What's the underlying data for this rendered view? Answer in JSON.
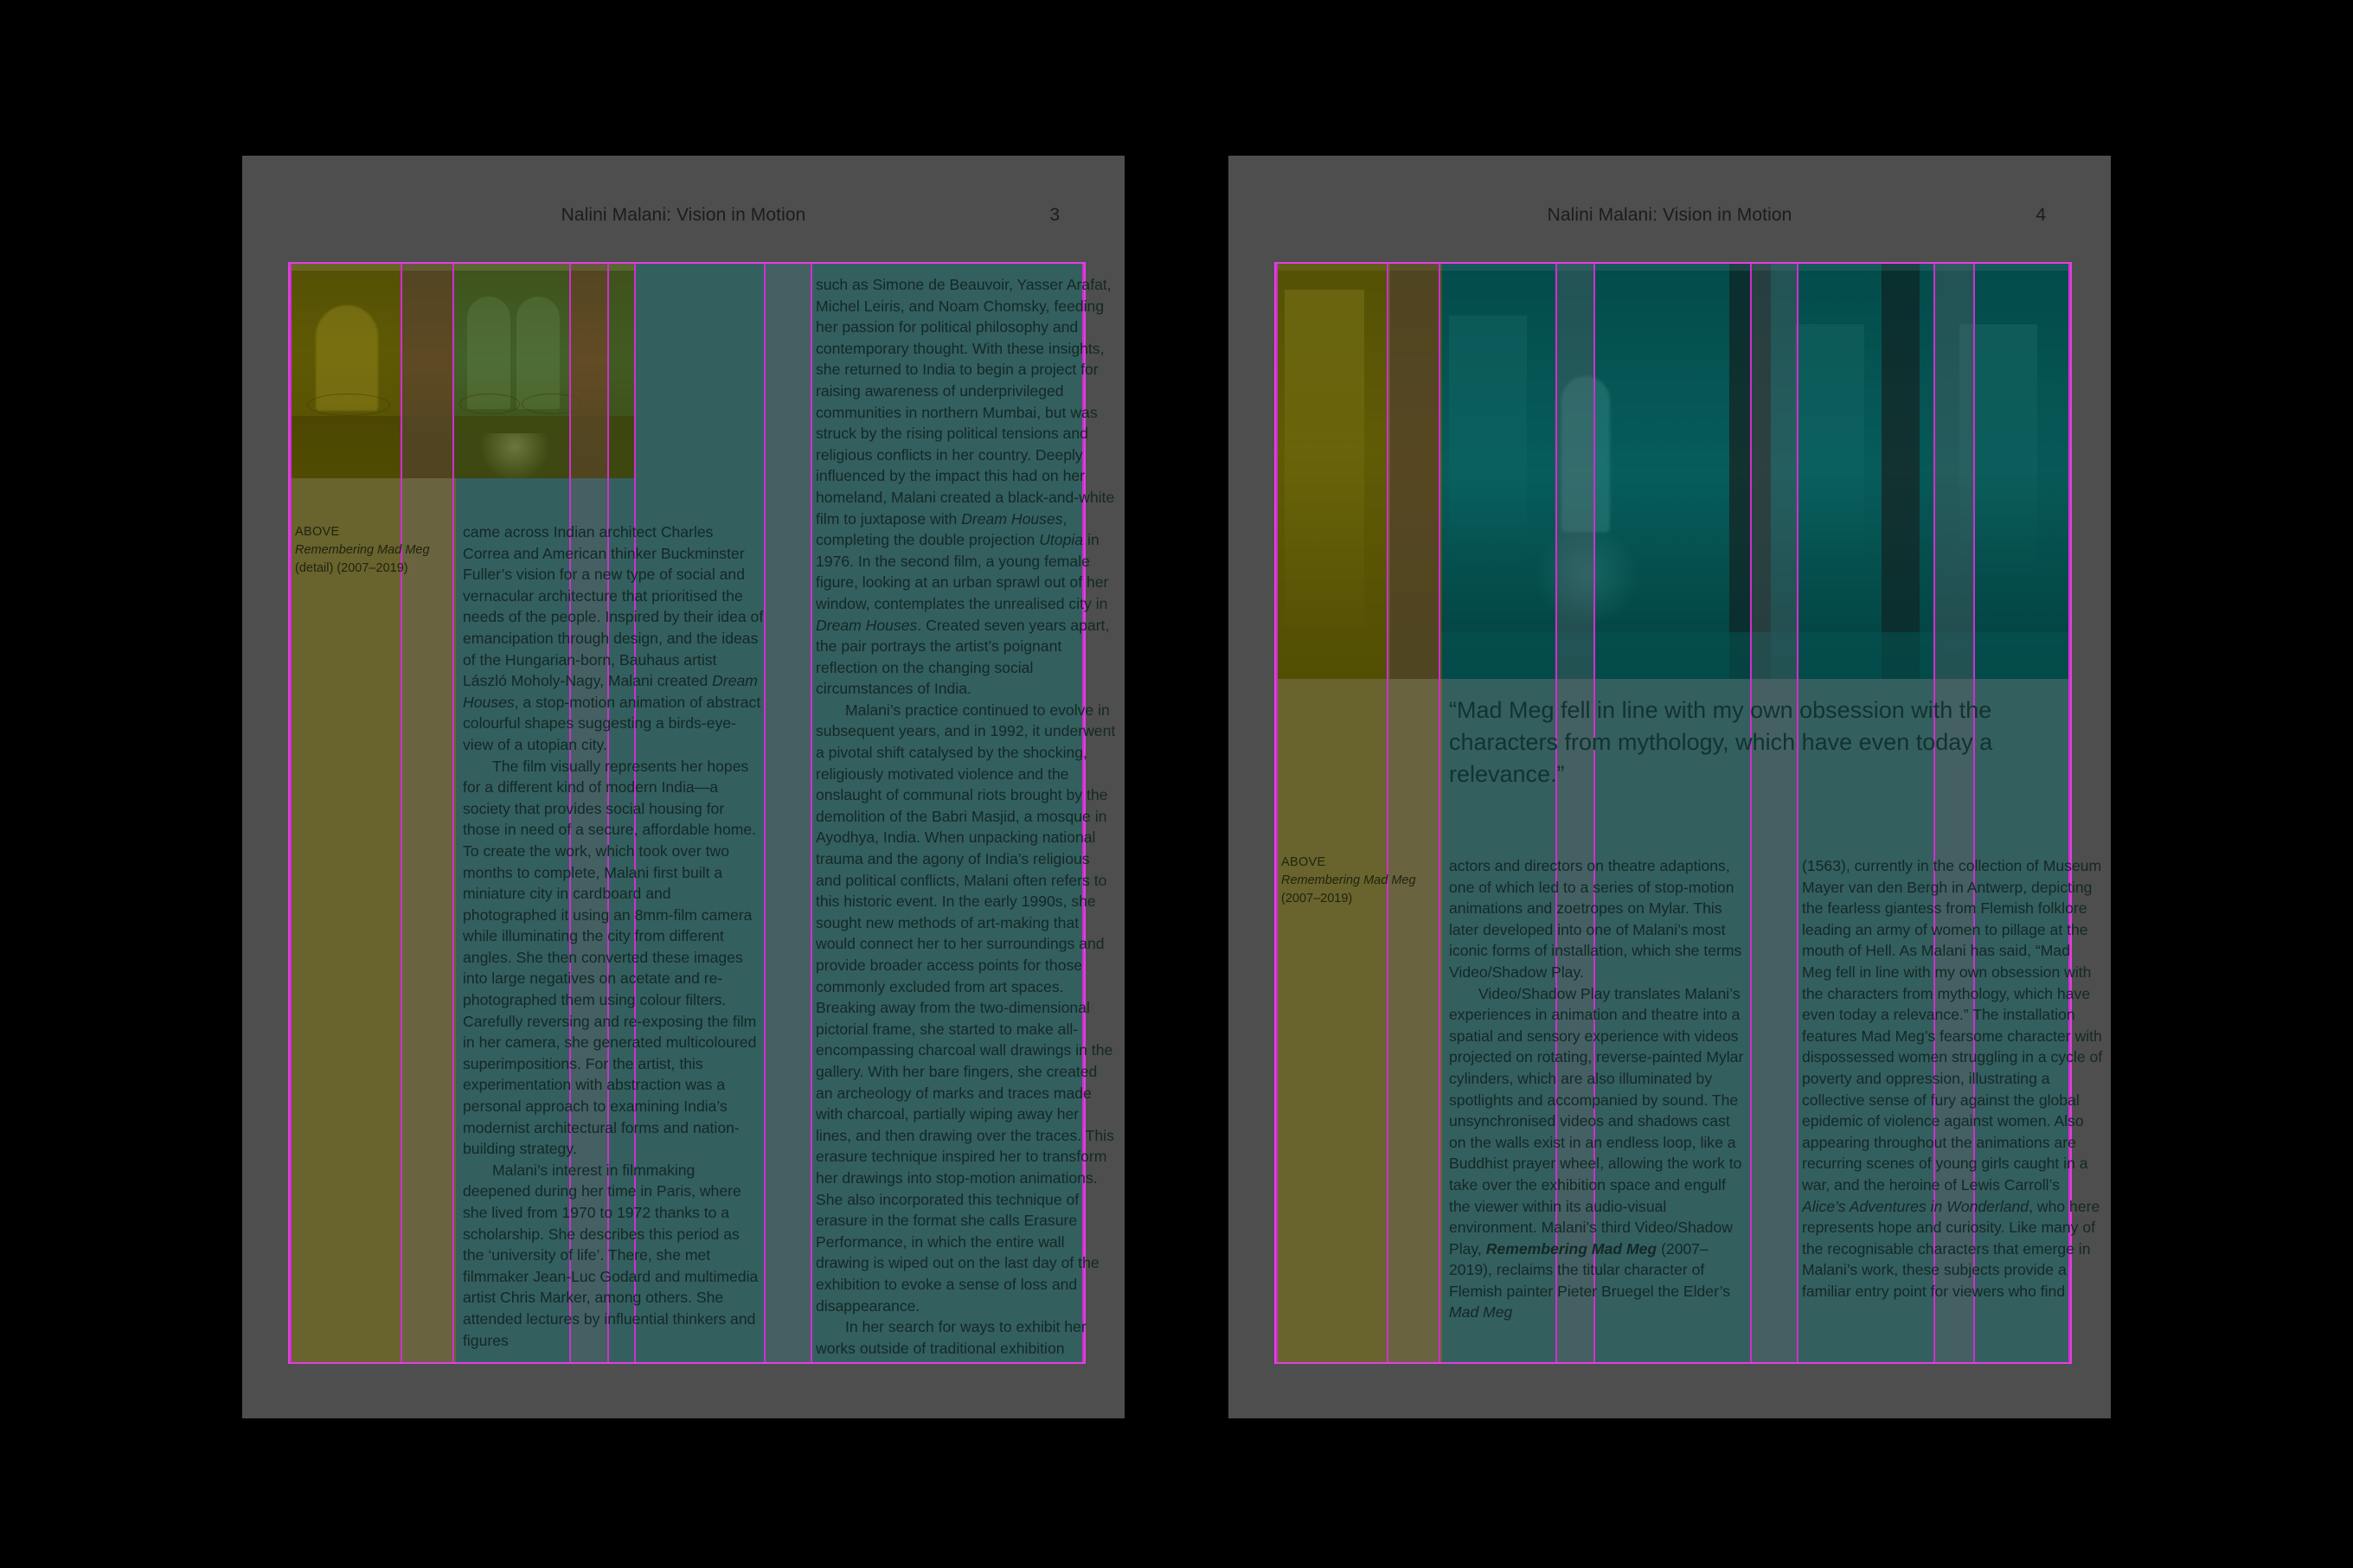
{
  "document": {
    "title": "Nalini Malani: Vision in Motion",
    "accent_guide_color": "#d02fd0",
    "page_color": "#4e4e4e",
    "canvas_color": "#000000",
    "teal_highlight_color": "#008080",
    "olive_highlight_color": "#908000"
  },
  "spread": {
    "left_page": {
      "header": {
        "title": "Nalini Malani: Vision in Motion",
        "folio": "3"
      },
      "caption": {
        "label": "ABOVE",
        "title": "Remembering Mad Meg",
        "detail": "(detail) (2007–2019)"
      },
      "columns": [
        {
          "name": "left-column",
          "paragraphs": [
            "came across Indian architect Charles Correa and American thinker Buckminster Fuller’s vision for a new type of social and vernacular architecture that prioritised the needs of the people. Inspired by their idea of emancipation through design, and the ideas of the Hungarian-born, Bauhaus artist László Moholy-Nagy, Malani created <em>Dream Houses</em>, a stop-motion animation of abstract colourful shapes suggesting a birds-eye-view of a utopian city.",
            "The film visually represents her hopes for a different kind of modern India—a society that provides social housing for those in need of a secure, affordable home. To create the work, which took over two months to complete, Malani first built a miniature city in cardboard and photographed it using an 8mm-film camera while illuminating the city from different angles. She then converted these images into large negatives on acetate and re-photographed them using colour filters. Carefully reversing and re-exposing the film in her camera, she generated multicoloured superimpositions. For the artist, this experimentation with abstraction was a personal approach to examining India’s modernist architectural forms and nation-building strategy.",
            "Malani’s interest in filmmaking deepened during her time in Paris, where she lived from 1970 to 1972 thanks to a scholarship. She describes this period as the ‘university of life’. There, she met filmmaker Jean-Luc Godard and multimedia artist Chris Marker, among others. She attended lectures by influential thinkers and figures"
          ]
        },
        {
          "name": "right-column",
          "paragraphs": [
            "such as Simone de Beauvoir, Yasser Arafat, Michel Leiris, and Noam Chomsky, feeding her passion for political philosophy and contemporary thought. With these insights, she returned to India to begin a project for raising awareness of underprivileged communities in northern Mumbai, but was struck by the rising political tensions and religious conflicts in her country. Deeply influenced by the impact this had on her homeland, Malani created a black-and-white film to juxtapose with <em>Dream Houses</em>, completing the double projection <em>Utopia</em> in 1976. In the second film, a young female figure, looking at an urban sprawl out of her window, contemplates the unrealised city in <em>Dream Houses</em>. Created seven years apart, the pair portrays the artist’s poignant reflection on the changing social circumstances of India.",
            "Malani’s practice continued to evolve in subsequent years, and in 1992, it underwent a pivotal shift catalysed by the shocking, religiously motivated violence and the onslaught of communal riots brought by the demolition of the Babri Masjid, a mosque in Ayodhya, India. When unpacking national trauma and the agony of India’s religious and political conflicts, Malani often refers to this historic event. In the early 1990s, she sought new methods of art-making that would connect her to her surroundings and provide broader access points for those commonly excluded from art spaces. Breaking away from the two-dimensional pictorial frame, she started to make all-encompassing charcoal wall drawings in the gallery. With her bare fingers, she created an archeology of marks and traces made with charcoal, partially wiping away her lines, and then drawing over the traces. This erasure technique inspired her to transform her drawings into stop-motion animations. She also incorporated this technique of erasure in the format she calls Erasure Performance, in which the entire wall drawing is wiped out on the last day of the exhibition to evoke a sense of loss and disappearance.",
            "In her search for ways to exhibit her works outside of traditional exhibition spaces, her practice became increasingly interdisciplinary and spilled into theatres and public places. She collaborated with"
          ]
        }
      ]
    },
    "right_page": {
      "header": {
        "title": "Nalini Malani: Vision in Motion",
        "folio": "4"
      },
      "pullquote": "“Mad Meg fell in line with my own obsession with the characters from mythology, which have even today a relevance.”",
      "caption": {
        "label": "ABOVE",
        "title": "Remembering Mad Meg",
        "detail": "(2007–2019)"
      },
      "columns": [
        {
          "name": "left-column",
          "paragraphs": [
            "actors and directors on theatre adaptions, one of which led to a series of stop-motion animations and zoetropes on Mylar. This later developed into one of Malani’s most iconic forms of installation, which she terms Video/Shadow Play.",
            "Video/Shadow Play translates Malani’s experiences in animation and theatre into a spatial and sensory experience with videos projected on rotating, reverse-painted Mylar cylinders, which are also illuminated by spotlights and accompanied by sound. The unsynchronised videos and shadows cast on the walls exist in an endless loop, like a Buddhist prayer wheel, allowing the work to take over the exhibition space and engulf the viewer within its audio-visual environment. Malani’s third Video/Shadow Play, <strong>Remembering Mad Meg</strong> (2007–2019), reclaims the titular character of Flemish painter Pieter Bruegel the Elder’s <em>Mad Meg</em>"
          ]
        },
        {
          "name": "right-column",
          "paragraphs": [
            "(1563), currently in the collection of Museum Mayer van den Bergh in Antwerp, depicting the fearless giantess from Flemish folklore leading an army of women to pillage at the mouth of Hell. As Malani has said, “Mad Meg fell in line with my own obsession with the characters from mythology, which have even today a relevance.” The installation features Mad Meg’s fearsome character with dispossessed women struggling in a cycle of poverty and oppression, illustrating a collective sense of fury against the global epidemic of violence against women. Also appearing throughout the animations are recurring scenes of young girls caught in a war, and the heroine of Lewis Carroll’s <em>Alice’s Adventures in Wonderland</em>, who here represents hope and curiosity. Like many of the recognisable characters that emerge in Malani’s work, these subjects provide a familiar entry point for viewers who find"
          ]
        }
      ]
    }
  }
}
